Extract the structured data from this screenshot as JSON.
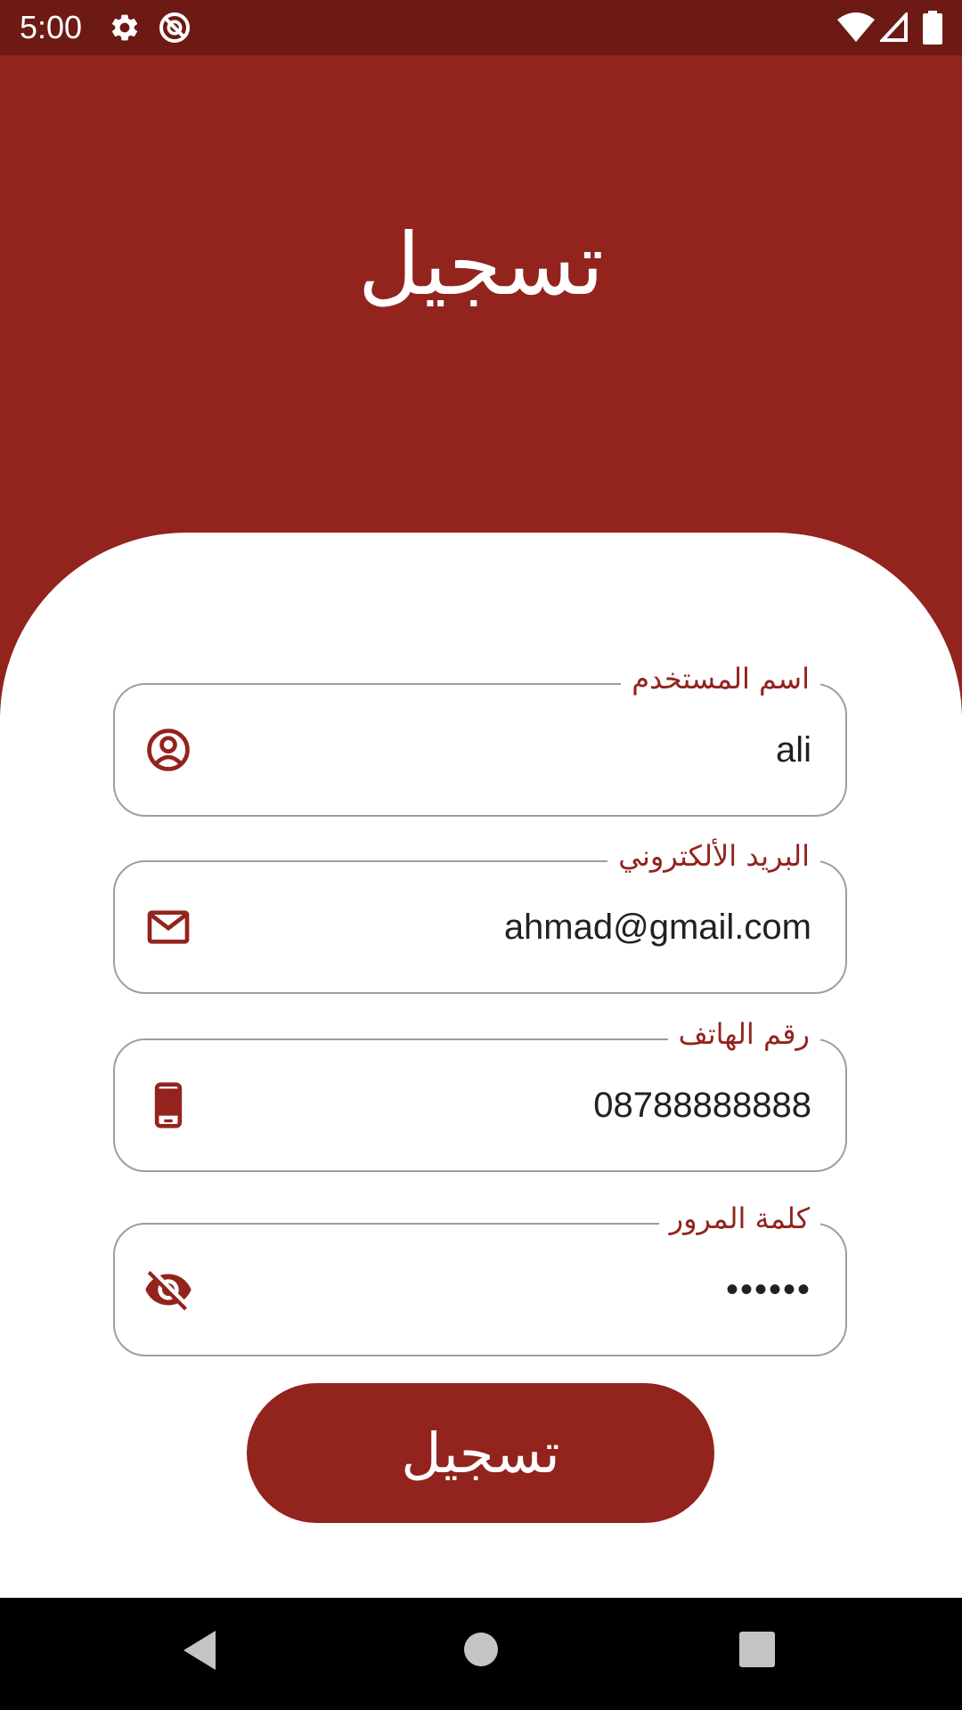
{
  "status_bar": {
    "time": "5:00",
    "icons": [
      "gear-icon",
      "do-not-disturb-icon",
      "wifi-icon",
      "signal-icon",
      "battery-icon"
    ]
  },
  "header": {
    "title": "تسجيل"
  },
  "form": {
    "fields": [
      {
        "label": "اسم المستخدم",
        "value": "ali",
        "icon": "account-circle-icon"
      },
      {
        "label": "البريد الألكتروني",
        "value": "ahmad@gmail.com",
        "icon": "mail-icon"
      },
      {
        "label": "رقم الهاتف",
        "value": "08788888888",
        "icon": "phone-icon"
      },
      {
        "label": "كلمة المرور",
        "value": "••••••",
        "icon": "visibility-off-icon"
      }
    ],
    "submit_label": "تسجيل"
  },
  "nav_bar": {
    "buttons": [
      "back-icon",
      "home-icon",
      "recents-icon"
    ]
  },
  "colors": {
    "primary": "#93231d",
    "status_bar": "#6d1a15",
    "field_border": "#9e9e9e",
    "text": "#212121"
  }
}
